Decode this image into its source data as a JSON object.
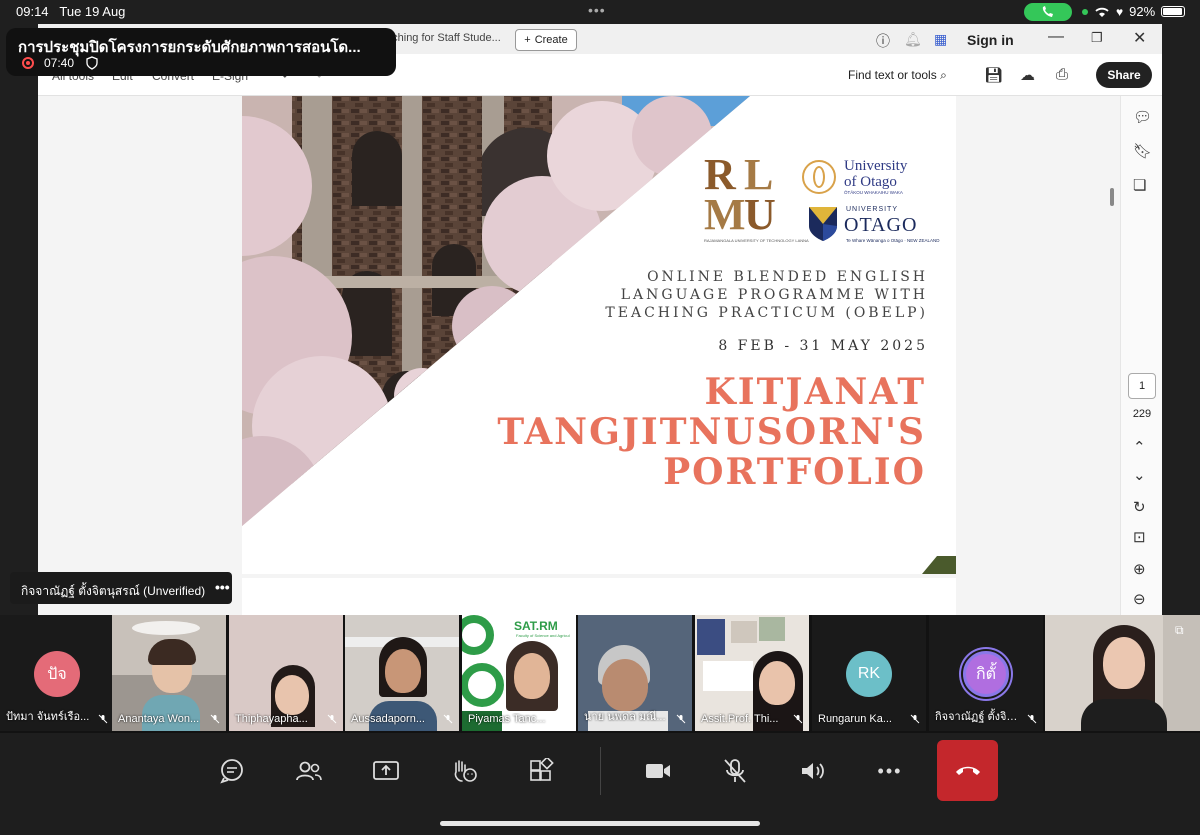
{
  "status_bar": {
    "time": "09:14",
    "date": "Tue 19 Aug",
    "battery": "92%"
  },
  "meeting": {
    "title": "การประชุมปิดโครงการยกระดับศักยภาพการสอนโด...",
    "duration": "07:40"
  },
  "acrobat": {
    "tab_title": "MUTL Teaching for Staff Stude...",
    "create_label": "Create",
    "sign_in": "Sign in",
    "menu": [
      "All tools",
      "Edit",
      "Convert",
      "E-Sign"
    ],
    "find_label": "Find text or tools",
    "share_label": "Share",
    "page_current": "1",
    "page_total": "229"
  },
  "pdf": {
    "logo_letters": [
      "R",
      "L",
      "M",
      "U"
    ],
    "rmutl_caption": "RAJAMANGALA UNIVERSITY OF TECHNOLOGY LANNA",
    "otago_name_1": "University",
    "otago_name_2": "of Otago",
    "otago_maori": "ŌTĀKOU WHAKAIHU WAKA",
    "otago2_univ": "UNIVERSITY",
    "otago2_of": "of",
    "otago2_name": "OTAGO",
    "otago2_motto": "Te Whare Wānanga o Otāgo · NEW ZEALAND",
    "program_line1": "ONLINE BLENDED ENGLISH",
    "program_line2": "LANGUAGE PROGRAMME WITH",
    "program_line3": "TEACHING PRACTICUM (OBELP)",
    "dates": "8 FEB - 31 MAY 2025",
    "title_line1": "KITJANAT",
    "title_line2": "TANGJITNUSORN'S",
    "title_line3": "PORTFOLIO"
  },
  "presenter_tag": "กิจจาณัฏฐ์ ตั้งจิตนุสรณ์ (Unverified)",
  "participants": [
    {
      "name": "ปัทมา จันทร์เรือ...",
      "initials": "ปัจ",
      "avatar_color": "#e46b78"
    },
    {
      "name": "Anantaya Won..."
    },
    {
      "name": "Thiphayapha..."
    },
    {
      "name": "Aussadaporn..."
    },
    {
      "name": "Piyamas Tanc..."
    },
    {
      "name": "นาย นพดล มณี..."
    },
    {
      "name": "Assit.Prof. Thi..."
    },
    {
      "name": "Rungarun Ka...",
      "initials": "RK",
      "avatar_color": "#6cbfc8"
    },
    {
      "name": "กิจจาณัฏฐ์ ตั้งจิตนุ...",
      "initials": "กิตั้",
      "avatar_color": "#b06ee0"
    },
    {
      "name": ""
    }
  ],
  "tile_texts": {
    "sat_logo": "SAT.RM",
    "sat_sub": "Faculty of Science and Agricul"
  },
  "colors": {
    "accent_title": "#e8735d",
    "hangup": "#c4272c",
    "call_pill": "#34c759"
  }
}
